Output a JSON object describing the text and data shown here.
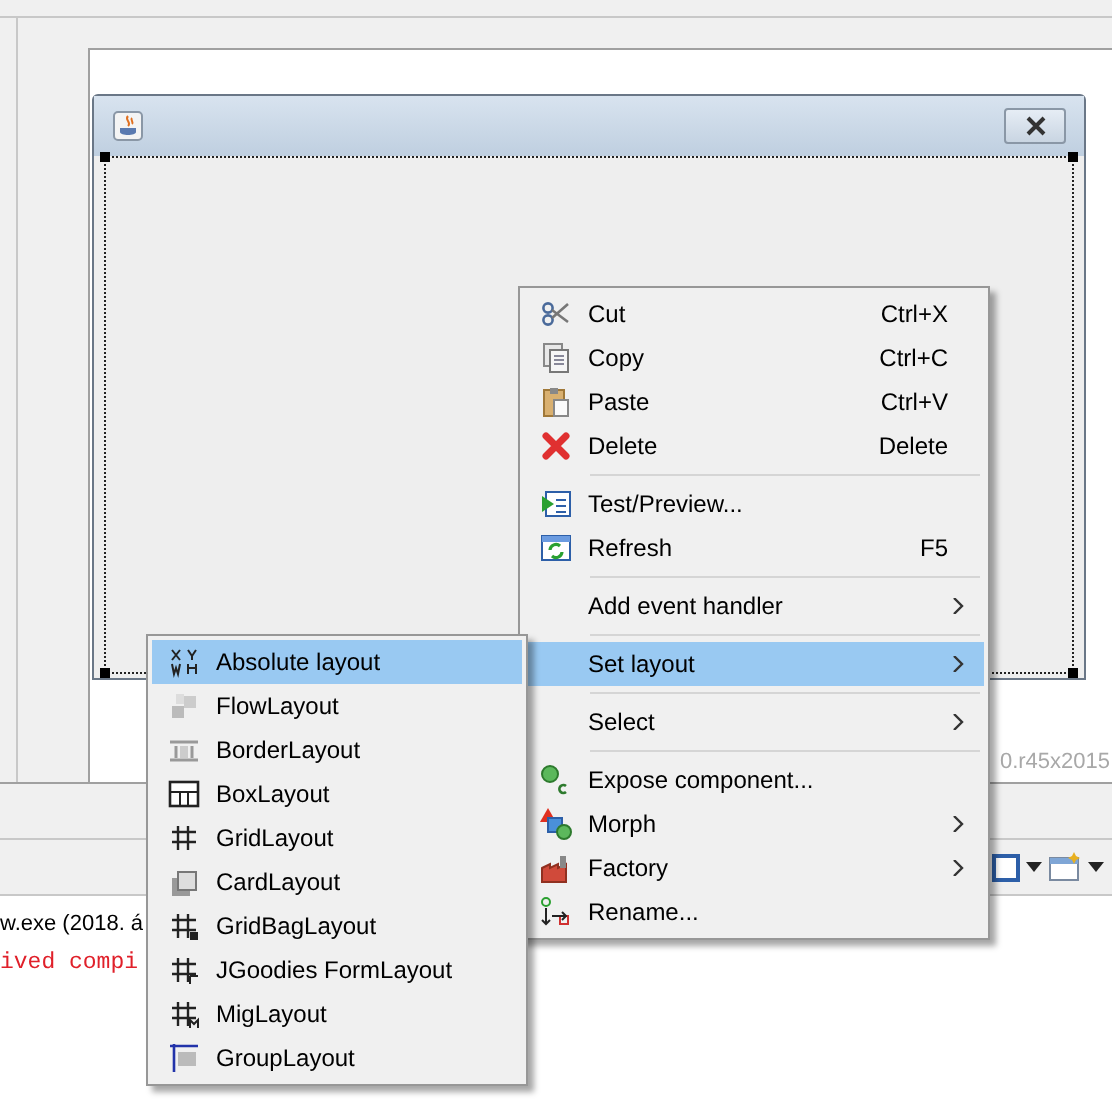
{
  "designer": {
    "frame": {
      "selected": true
    },
    "version_text": "0.r45x2015"
  },
  "console": {
    "lines": [
      {
        "text": "w.exe (2018. á",
        "kind": "info"
      },
      {
        "text": "ived compi",
        "kind": "error"
      }
    ]
  },
  "context_menu": {
    "items": [
      {
        "kind": "item",
        "label": "Cut",
        "shortcut": "Ctrl+X",
        "has_submenu": false,
        "selected": false
      },
      {
        "kind": "item",
        "label": "Copy",
        "shortcut": "Ctrl+C",
        "has_submenu": false,
        "selected": false
      },
      {
        "kind": "item",
        "label": "Paste",
        "shortcut": "Ctrl+V",
        "has_submenu": false,
        "selected": false
      },
      {
        "kind": "item",
        "label": "Delete",
        "shortcut": "Delete",
        "has_submenu": false,
        "selected": false
      },
      {
        "kind": "separator"
      },
      {
        "kind": "item",
        "label": "Test/Preview...",
        "has_submenu": false,
        "selected": false
      },
      {
        "kind": "item",
        "label": "Refresh",
        "shortcut": "F5",
        "has_submenu": false,
        "selected": false
      },
      {
        "kind": "separator"
      },
      {
        "kind": "item",
        "label": "Add event handler",
        "has_submenu": true,
        "selected": false
      },
      {
        "kind": "separator"
      },
      {
        "kind": "item",
        "label": "Set layout",
        "has_submenu": true,
        "selected": true
      },
      {
        "kind": "separator"
      },
      {
        "kind": "item",
        "label": "Select",
        "has_submenu": true,
        "selected": false
      },
      {
        "kind": "separator"
      },
      {
        "kind": "item",
        "label": "Expose component...",
        "has_submenu": false,
        "selected": false
      },
      {
        "kind": "item",
        "label": "Morph",
        "has_submenu": true,
        "selected": false
      },
      {
        "kind": "item",
        "label": "Factory",
        "has_submenu": true,
        "selected": false
      },
      {
        "kind": "item",
        "label": "Rename...",
        "has_submenu": false,
        "selected": false
      }
    ]
  },
  "layout_submenu": {
    "items": [
      {
        "label": "Absolute layout",
        "selected": true
      },
      {
        "label": "FlowLayout",
        "selected": false
      },
      {
        "label": "BorderLayout",
        "selected": false
      },
      {
        "label": "BoxLayout",
        "selected": false
      },
      {
        "label": "GridLayout",
        "selected": false
      },
      {
        "label": "CardLayout",
        "selected": false
      },
      {
        "label": "GridBagLayout",
        "selected": false
      },
      {
        "label": "JGoodies FormLayout",
        "selected": false
      },
      {
        "label": "MigLayout",
        "selected": false
      },
      {
        "label": "GroupLayout",
        "selected": false
      }
    ]
  }
}
